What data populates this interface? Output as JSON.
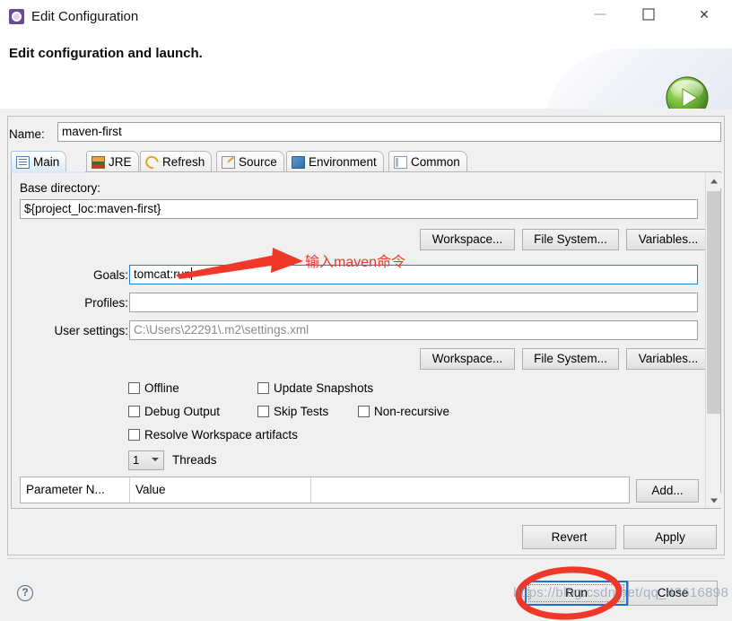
{
  "window": {
    "title": "Edit Configuration",
    "icon": "configuration-gear-icon",
    "minimize_label": "—",
    "maximize_label": "□",
    "close_label": "✕"
  },
  "header": {
    "title": "Edit configuration and launch.",
    "run_badge_icon": "green-run-play-icon"
  },
  "name_field": {
    "label": "Name:",
    "value": "maven-first",
    "placeholder": ""
  },
  "tabs": [
    {
      "label": "Main",
      "icon": "main-document-icon",
      "selected": true
    },
    {
      "label": "JRE",
      "icon": "jre-books-icon",
      "selected": false
    },
    {
      "label": "Refresh",
      "icon": "refresh-arrows-icon",
      "selected": false
    },
    {
      "label": "Source",
      "icon": "source-pencil-icon",
      "selected": false
    },
    {
      "label": "Environment",
      "icon": "environment-monitor-icon",
      "selected": false
    },
    {
      "label": "Common",
      "icon": "common-table-icon",
      "selected": false
    }
  ],
  "main_tab": {
    "base_directory": {
      "label": "Base directory:",
      "value": "${project_loc:maven-first}"
    },
    "dir_buttons": [
      {
        "label": "Workspace..."
      },
      {
        "label": "File System..."
      },
      {
        "label": "Variables..."
      }
    ],
    "goals": {
      "label": "Goals:",
      "value": "tomcat:run",
      "focused": true
    },
    "profiles": {
      "label": "Profiles:",
      "value": ""
    },
    "user_settings": {
      "label": "User settings:",
      "value": "",
      "placeholder": "C:\\Users\\22291\\.m2\\settings.xml"
    },
    "settings_buttons": [
      {
        "label": "Workspace..."
      },
      {
        "label": "File System..."
      },
      {
        "label": "Variables..."
      }
    ],
    "checkboxes": [
      {
        "label": "Offline",
        "checked": false
      },
      {
        "label": "Update Snapshots",
        "checked": false
      },
      {
        "label": "Debug Output",
        "checked": false
      },
      {
        "label": "Skip Tests",
        "checked": false
      },
      {
        "label": "Non-recursive",
        "checked": false
      },
      {
        "label": "Resolve Workspace artifacts",
        "checked": false
      }
    ],
    "threads": {
      "value": "1",
      "label": "Threads"
    },
    "parameter_table": {
      "columns": [
        "Parameter N...",
        "Value"
      ],
      "rows": []
    },
    "add_button": {
      "label": "Add..."
    }
  },
  "footer": {
    "revert_label": "Revert",
    "apply_label": "Apply",
    "run_label": "Run",
    "close_label": "Close",
    "help_icon": "help-question-icon",
    "help_glyph": "?"
  },
  "annotations": {
    "arrow_note": "输入maven命令",
    "arrow_color": "#f0382a",
    "circle_color": "#f0382a",
    "watermark": "https://blog.csdn.net/qq_43616898"
  }
}
